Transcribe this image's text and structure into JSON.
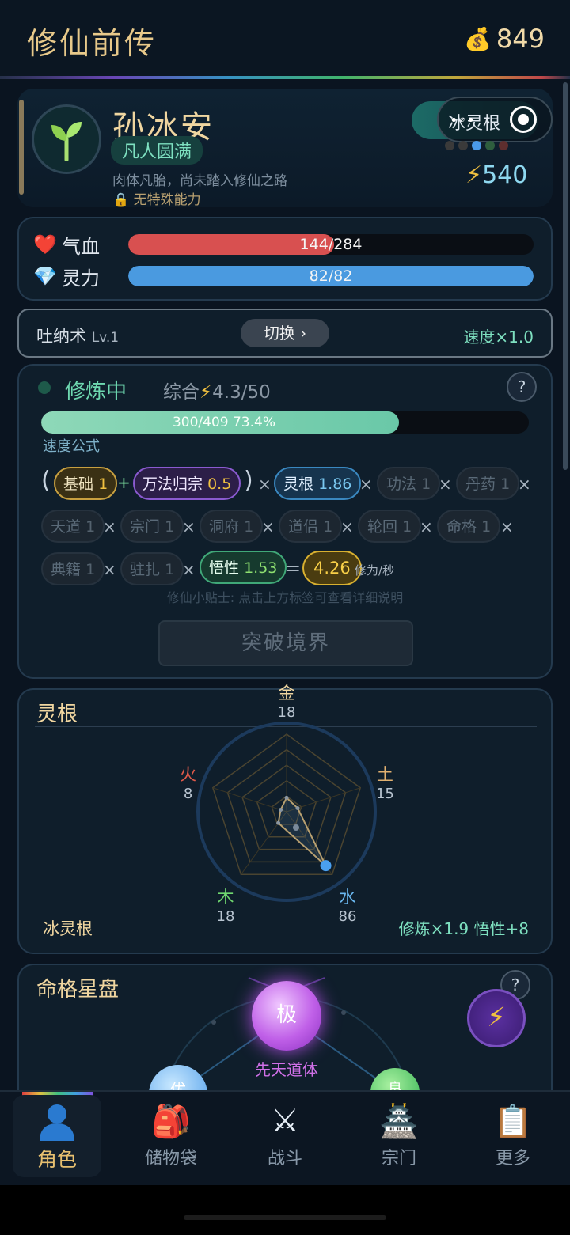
{
  "header": {
    "title": "修仙前传",
    "money": "849",
    "money_icon": "money-bag-icon"
  },
  "profile": {
    "name": "孙冰安",
    "realm": "凡人圆满",
    "description": "肉体凡胎，尚未踏入修仙之路",
    "ability": "无特殊能力",
    "root_toggle_label": "冰灵根",
    "root_overlay": "•◦•",
    "power_icon": "⚡",
    "power": "540",
    "dot_colors": [
      "#3a3a3a",
      "#3a3a3a",
      "#4a9ae8",
      "#2e5e3e",
      "#5e2e2e"
    ]
  },
  "vitals": {
    "hp_label": "气血",
    "hp_text": "144/284",
    "hp_ratio": 0.507,
    "hp_color": "#d85050",
    "mp_label": "灵力",
    "mp_text": "82/82",
    "mp_ratio": 1.0,
    "mp_color": "#4a9ae0"
  },
  "technique": {
    "name": "吐纳术",
    "level": "Lv.1",
    "switch_label": "切换 ›",
    "speed": "速度×1.0"
  },
  "cultivation": {
    "status": "修炼中",
    "combined_label": "综合",
    "combined_icon": "⚡",
    "combined_value": "4.3/50",
    "help": "?",
    "exp_text": "300/409  73.4%",
    "exp_ratio": 0.734,
    "formula_label": "速度公式",
    "chips": {
      "base": {
        "label": "基础",
        "value": "1"
      },
      "wanfa": {
        "label": "万法归宗",
        "value": "0.5"
      },
      "root": {
        "label": "灵根",
        "value": "1.86"
      },
      "gongfa": {
        "label": "功法",
        "value": "1"
      },
      "danyao": {
        "label": "丹药",
        "value": "1"
      },
      "tiandao": {
        "label": "天道",
        "value": "1"
      },
      "zongmen": {
        "label": "宗门",
        "value": "1"
      },
      "dongfu": {
        "label": "洞府",
        "value": "1"
      },
      "daolv": {
        "label": "道侣",
        "value": "1"
      },
      "lunhui": {
        "label": "轮回",
        "value": "1"
      },
      "mingge": {
        "label": "命格",
        "value": "1"
      },
      "dianji": {
        "label": "典籍",
        "value": "1"
      },
      "zhuzha": {
        "label": "驻扎",
        "value": "1"
      },
      "wuxing": {
        "label": "悟性",
        "value": "1.53"
      }
    },
    "ops": {
      "lparen": "(",
      "rparen": ")",
      "plus": "+",
      "times": "×",
      "equals": "="
    },
    "result": "4.26",
    "unit": "修为/秒",
    "tip": "修仙小贴士: 点击上方标签可查看详细说明",
    "breakthrough": "突破境界"
  },
  "spirit_root": {
    "title": "灵根",
    "elements": [
      {
        "name": "金",
        "value": 18,
        "color": "#f0d6a0"
      },
      {
        "name": "土",
        "value": 15,
        "color": "#e0b070"
      },
      {
        "name": "水",
        "value": 86,
        "color": "#6ab8f0"
      },
      {
        "name": "木",
        "value": 18,
        "color": "#70d870"
      },
      {
        "name": "火",
        "value": 8,
        "color": "#e05a4a"
      }
    ],
    "root_name": "冰灵根",
    "bonus": "修炼×1.9  悟性+8"
  },
  "fate": {
    "title": "命格星盘",
    "help": "?",
    "main_orb": "极",
    "main_label": "先天道体",
    "left_orb": "优",
    "right_orb": "良",
    "float_icon": "⚡"
  },
  "tabs": [
    {
      "label": "角色",
      "icon": "👤",
      "icon_name": "person-icon"
    },
    {
      "label": "储物袋",
      "icon": "🎒",
      "icon_name": "backpack-icon"
    },
    {
      "label": "战斗",
      "icon": "⚔",
      "icon_name": "swords-icon"
    },
    {
      "label": "宗门",
      "icon": "🏯",
      "icon_name": "temple-icon"
    },
    {
      "label": "更多",
      "icon": "📋",
      "icon_name": "clipboard-icon"
    }
  ]
}
